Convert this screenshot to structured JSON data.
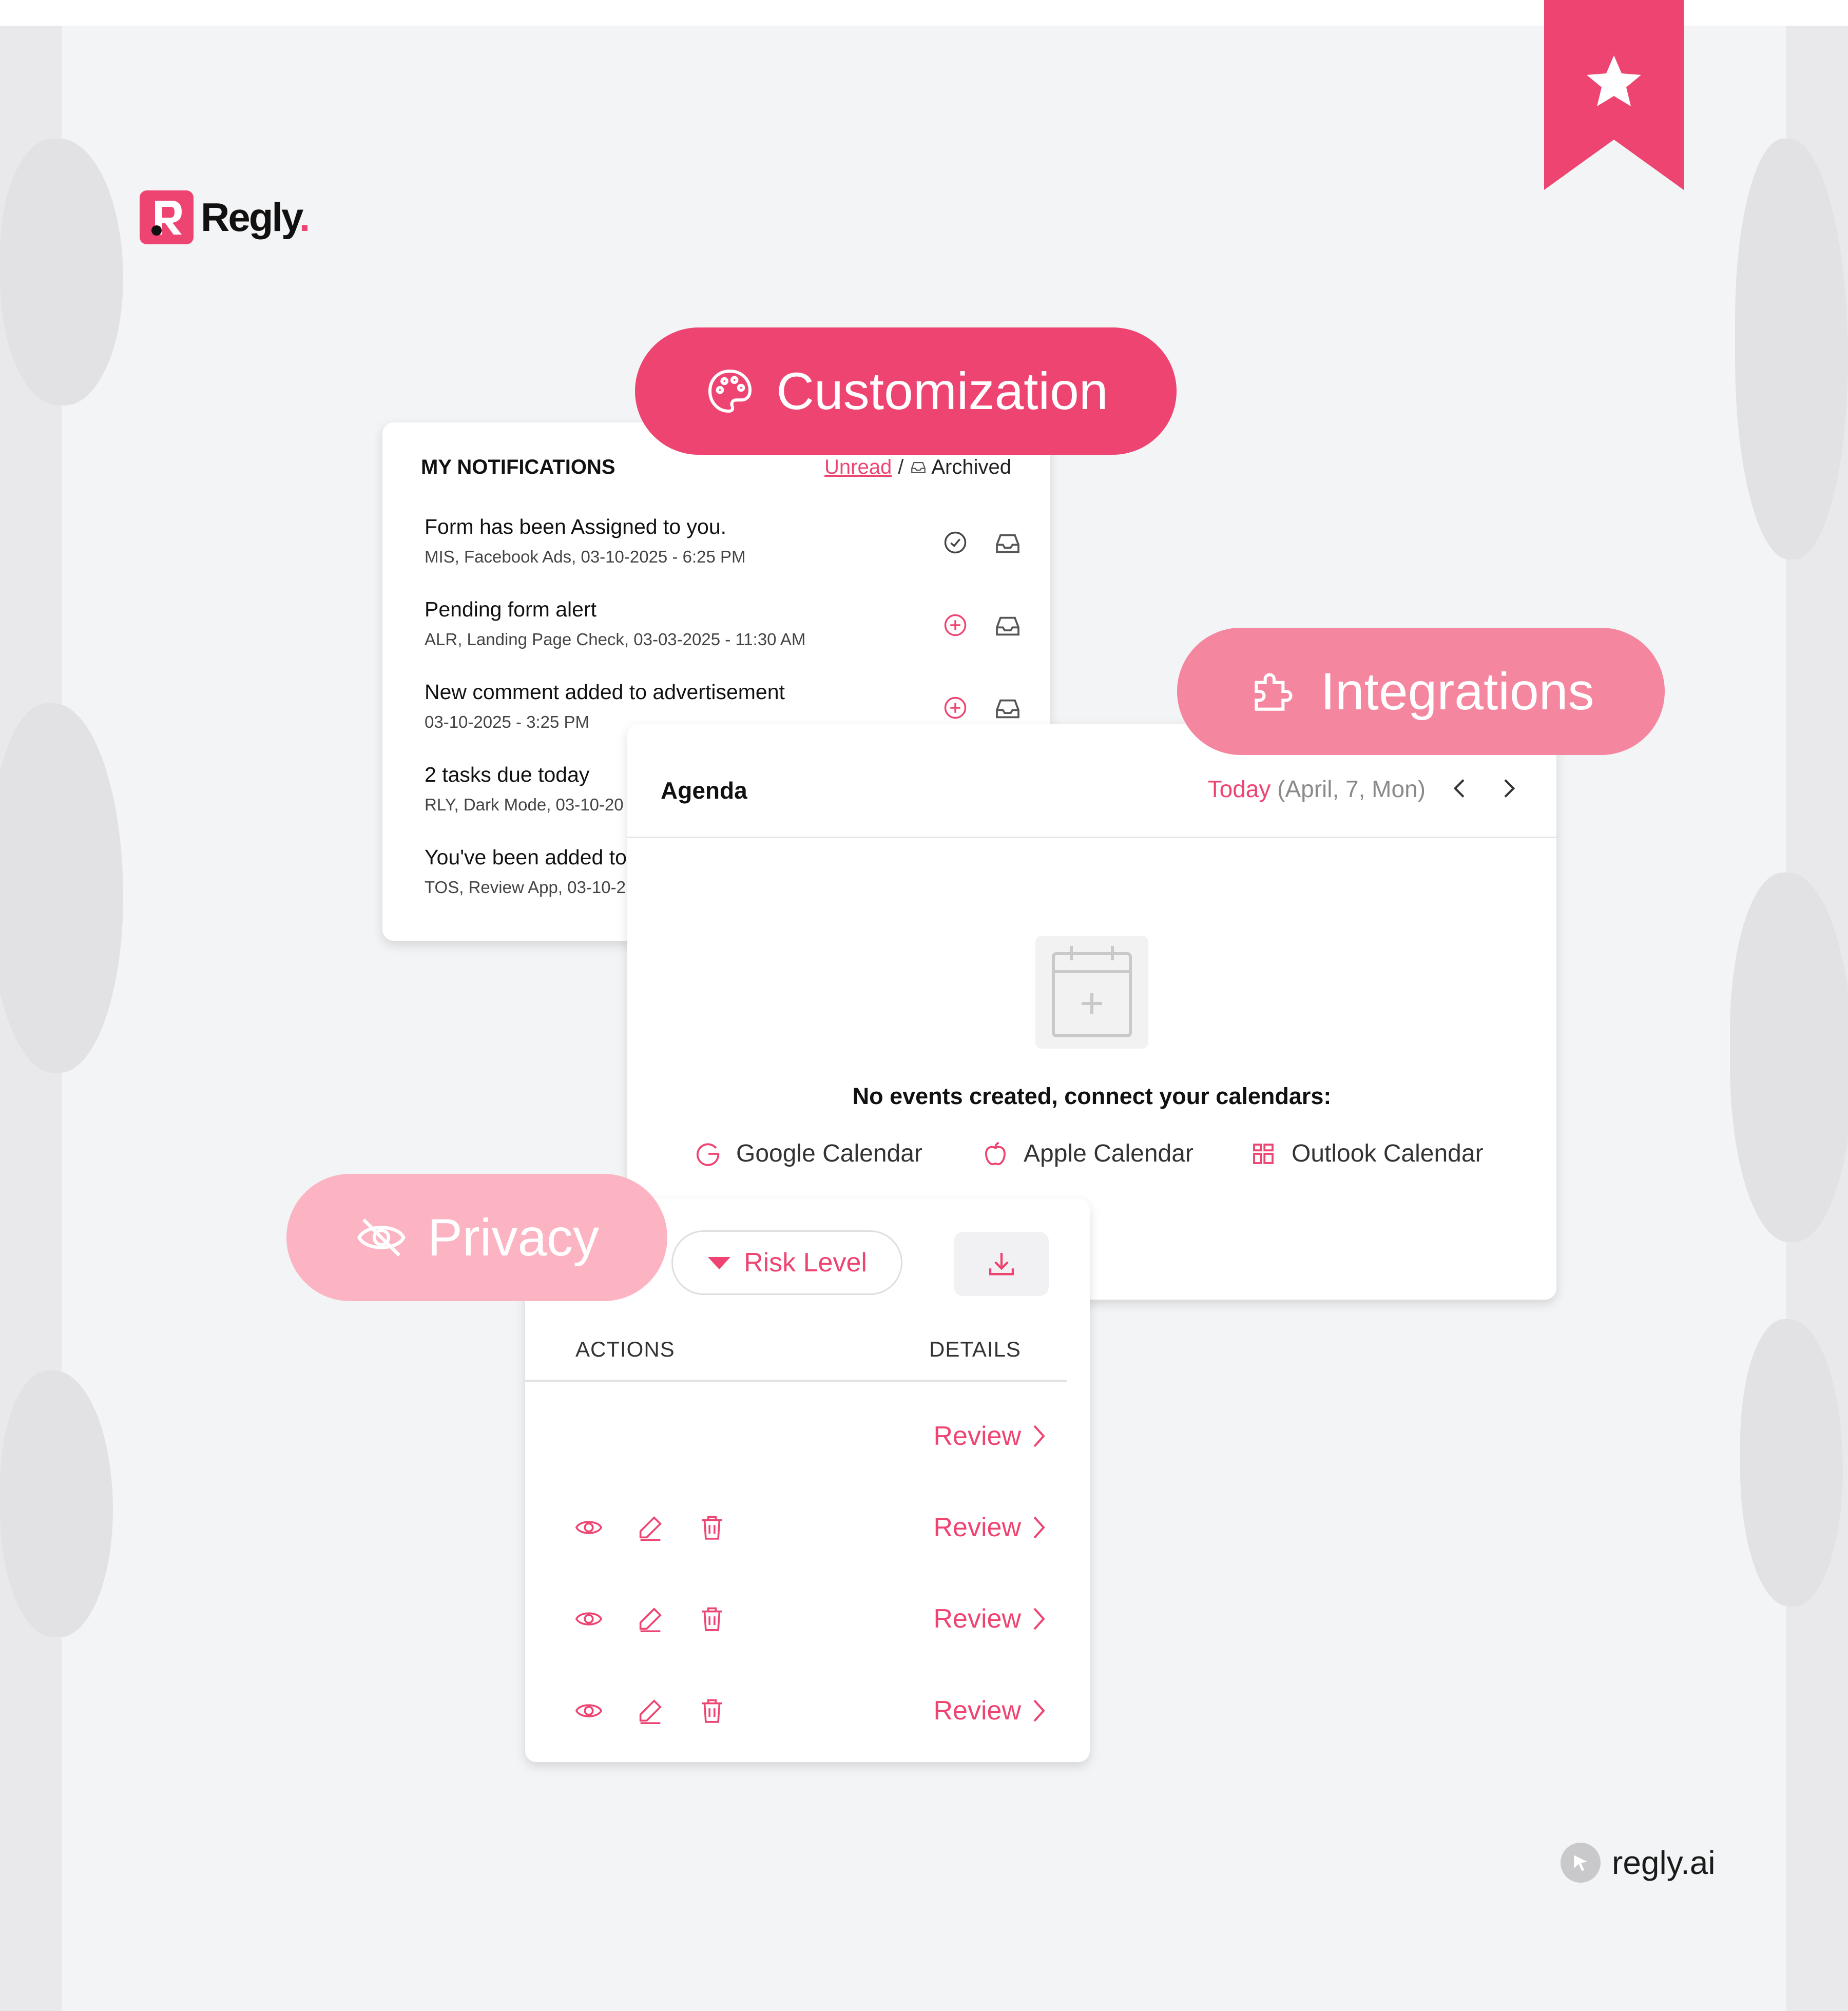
{
  "brand": {
    "name": "Regly",
    "dot": ".",
    "site": "regly.ai"
  },
  "pills": {
    "customization": "Customization",
    "integrations": "Integrations",
    "privacy": "Privacy"
  },
  "notifications": {
    "title": "MY NOTIFICATIONS",
    "tab_unread": "Unread",
    "tab_sep": "/",
    "tab_archived": "Archived",
    "items": [
      {
        "title": "Form has been Assigned to you.",
        "sub": "MIS, Facebook Ads, 03-10-2025 - 6:25 PM",
        "status": "check-circle-icon"
      },
      {
        "title": "Pending form alert",
        "sub": "ALR, Landing Page Check, 03-03-2025 - 11:30 AM",
        "status": "plus-circle-icon"
      },
      {
        "title": "New comment added to advertisement",
        "sub": "03-10-2025 - 3:25 PM",
        "status": "plus-circle-icon"
      },
      {
        "title": "2 tasks due today",
        "sub": "RLY, Dark Mode, 03-10-20"
      },
      {
        "title": "You've been added to",
        "sub": "TOS, Review App, 03-10-2"
      }
    ]
  },
  "agenda": {
    "title": "Agenda",
    "today": "Today",
    "date": "(April, 7, Mon)",
    "empty_message": "No events created, connect your calendars:",
    "calendars": [
      "Google Calendar",
      "Apple Calendar",
      "Outlook Calendar"
    ]
  },
  "risk": {
    "filter_label": "Risk Level",
    "col_actions": "ACTIONS",
    "col_details": "DETAILS",
    "review_label": "Review"
  },
  "colors": {
    "accent": "#ee4471",
    "integrations": "#f5869f",
    "privacy": "#fcb4c3",
    "background": "#f3f4f6"
  }
}
